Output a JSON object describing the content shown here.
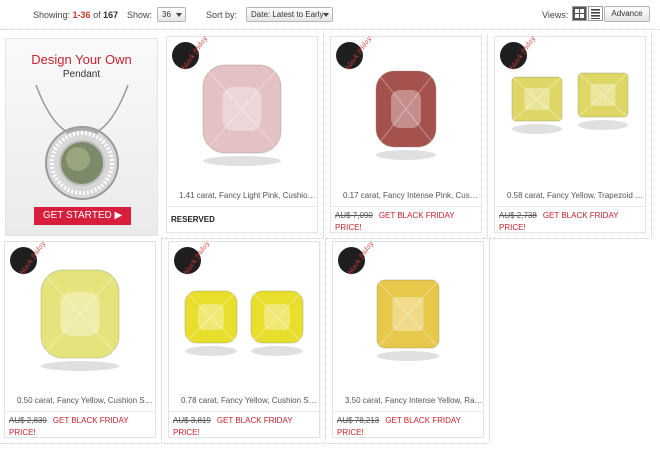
{
  "toolbar": {
    "showing_label": "Showing:",
    "range": "1-36",
    "of_label": "of",
    "total": "167",
    "show_label": "Show:",
    "per_page": "36",
    "sort_label": "Sort by:",
    "sort_value": "Date: Latest to Early",
    "views_label": "Views:",
    "advance_label": "Advance"
  },
  "promo": {
    "title": "Design Your Own",
    "subtitle": "Pendant",
    "button": "GET STARTED ▶"
  },
  "badge_text": "black friday",
  "products": [
    {
      "title": "1.41 carat, Fancy Light Pink, Cushion ...",
      "old_price": "",
      "action": "",
      "reserved": "RESERVED",
      "color": "#e3c1c4"
    },
    {
      "title": "0.17 carat, Fancy Intense Pink, Cushi...",
      "old_price": "AU$ 7,090",
      "action": "GET BLACK FRIDAY PRICE!",
      "reserved": "",
      "color": "#a5524f"
    },
    {
      "title": "0.58 carat, Fancy Yellow, Trapezoid S...",
      "old_price": "AU$ 2,738",
      "action": "GET BLACK FRIDAY PRICE!",
      "reserved": "",
      "color": "#ded766"
    },
    {
      "title": "0.50 carat, Fancy Yellow, Cushion Sh...",
      "old_price": "AU$ 2,839",
      "action": "GET BLACK FRIDAY PRICE!",
      "reserved": "",
      "color": "#e5e37c"
    },
    {
      "title": "0.78 carat, Fancy Yellow, Cushion Sh...",
      "old_price": "AU$ 3,819",
      "action": "GET BLACK FRIDAY PRICE!",
      "reserved": "",
      "color": "#e8de2c"
    },
    {
      "title": "3.50 carat, Fancy Intense Yellow, Rad...",
      "old_price": "AU$ 78,213",
      "action": "GET BLACK FRIDAY PRICE!",
      "reserved": "",
      "color": "#e6c84a"
    }
  ]
}
